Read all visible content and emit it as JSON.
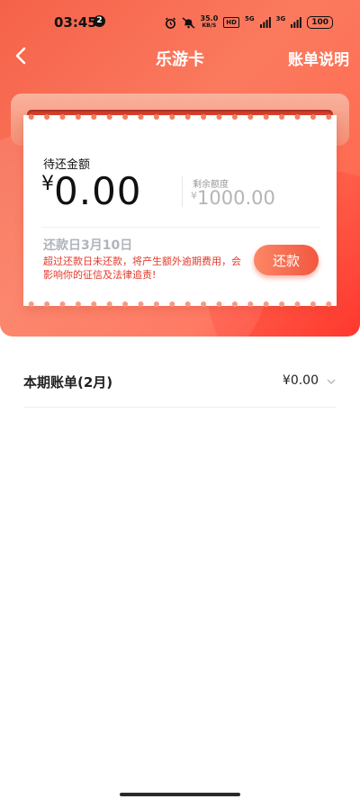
{
  "status_bar": {
    "time": "03:45",
    "notification_count": "2",
    "net_speed_value": "35.0",
    "net_speed_unit": "KB/S",
    "hd_label": "HD",
    "signal_1": "5G",
    "signal_2": "3G",
    "battery": "100"
  },
  "nav": {
    "title": "乐游卡",
    "right_link": "账单说明"
  },
  "card": {
    "due_label": "待还金额",
    "currency": "¥",
    "due_amount": "0.00",
    "remaining_label": "剩余额度",
    "remaining_amount": "1000.00",
    "due_day": "还款日3月10日",
    "warning": "超过还款日未还款，将产生额外逾期费用，会影响你的征信及法律追责!",
    "pay_button": "还款"
  },
  "bill": {
    "label": "本期账单(2月)",
    "amount": "¥0.00"
  },
  "colors": {
    "accent": "#f2573f",
    "warning": "#e23a2b",
    "slot": "#d8402a"
  }
}
